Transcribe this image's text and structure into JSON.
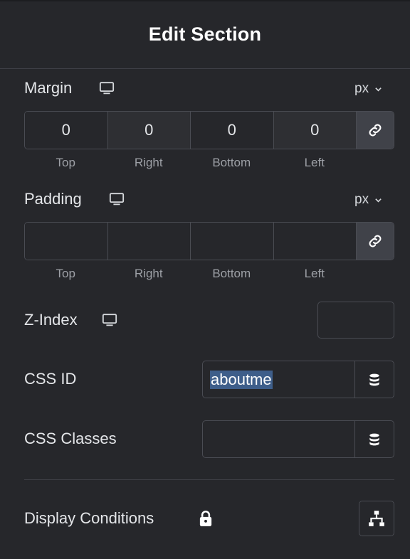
{
  "header": {
    "title": "Edit Section"
  },
  "margin": {
    "label": "Margin",
    "unit": "px",
    "values": [
      "0",
      "0",
      "0",
      "0"
    ],
    "sides": [
      "Top",
      "Right",
      "Bottom",
      "Left"
    ]
  },
  "padding": {
    "label": "Padding",
    "unit": "px",
    "values": [
      "",
      "",
      "",
      ""
    ],
    "sides": [
      "Top",
      "Right",
      "Bottom",
      "Left"
    ]
  },
  "zindex": {
    "label": "Z-Index",
    "value": ""
  },
  "cssid": {
    "label": "CSS ID",
    "value": "aboutme"
  },
  "cssclasses": {
    "label": "CSS Classes",
    "value": ""
  },
  "conditions": {
    "label": "Display Conditions"
  },
  "colors": {
    "background": "#26272b",
    "border": "#4a4c53",
    "selection": "#3e5e8a"
  }
}
